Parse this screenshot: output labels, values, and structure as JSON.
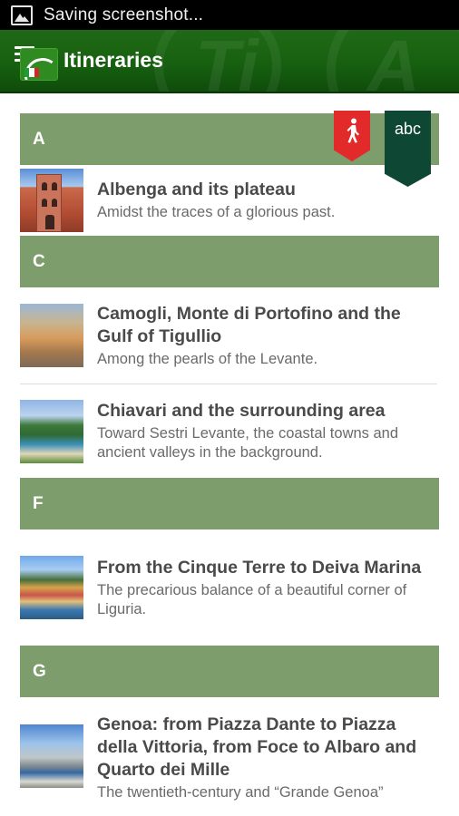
{
  "status_bar": {
    "notification_icon": "image-icon",
    "text": "Saving screenshot..."
  },
  "action_bar": {
    "title": "Itineraries",
    "menu_icon": "menu-icon",
    "logo": "app-logo"
  },
  "ribbons": {
    "walk_icon": "pedestrian-icon",
    "sort_label": "abc",
    "colors": {
      "red": "#e22a2a",
      "green": "#0e4734"
    }
  },
  "colors": {
    "header_green": "#176010",
    "section_green": "#7d9e6c"
  },
  "sections": [
    {
      "letter": "A",
      "items": [
        {
          "title": "Albenga and its plateau",
          "subtitle": "Amidst the traces of a glorious past."
        }
      ]
    },
    {
      "letter": "C",
      "items": [
        {
          "title": "Camogli, Monte di Portofino and the Gulf of Tigullio",
          "subtitle": "Among the pearls of the Levante."
        },
        {
          "title": "Chiavari and the surrounding area",
          "subtitle": "Toward Sestri Levante, the coastal towns and ancient valleys in the background."
        }
      ]
    },
    {
      "letter": "F",
      "items": [
        {
          "title": "From the Cinque Terre to Deiva Marina",
          "subtitle": "The precarious balance of a beautiful corner of Liguria."
        }
      ]
    },
    {
      "letter": "G",
      "items": [
        {
          "title": "Genoa: from Piazza Dante to Piazza della Vittoria, from Foce to Albaro and Quarto dei Mille",
          "subtitle": "The twentieth-century and “Grande Genoa”"
        }
      ]
    }
  ]
}
